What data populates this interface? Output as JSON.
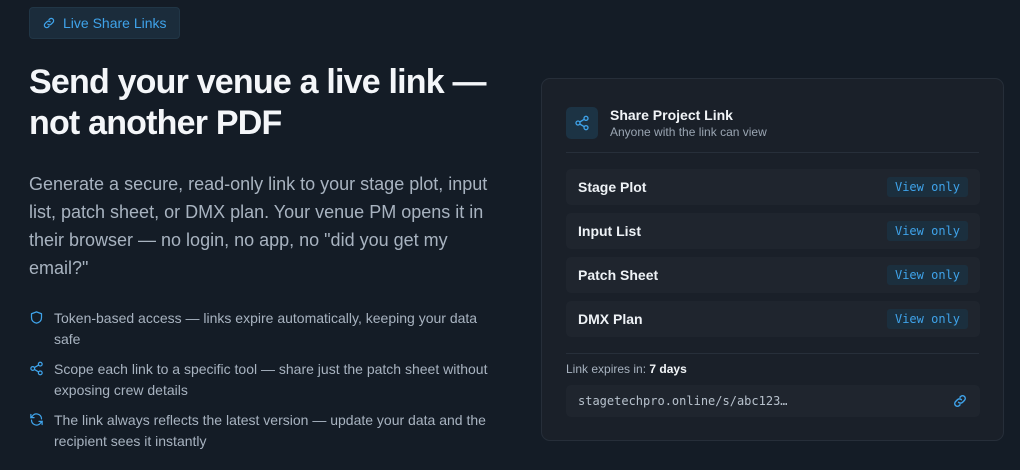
{
  "badge": {
    "label": "Live Share Links",
    "icon": "link-icon"
  },
  "hero": {
    "headline": "Send your venue a live link — not another PDF",
    "lead": "Generate a secure, read-only link to your stage plot, input list, patch sheet, or DMX plan. Your venue PM opens it in their browser — no login, no app, no \"did you get my email?\""
  },
  "features": [
    {
      "icon": "shield-icon",
      "text": "Token-based access — links expire automatically, keeping your data safe"
    },
    {
      "icon": "share-icon",
      "text": "Scope each link to a specific tool — share just the patch sheet without exposing crew details"
    },
    {
      "icon": "refresh-icon",
      "text": "The link always reflects the latest version — update your data and the recipient sees it instantly"
    }
  ],
  "card": {
    "title": "Share Project Link",
    "subtitle": "Anyone with the link can view",
    "items": [
      {
        "name": "Stage Plot",
        "access": "View only"
      },
      {
        "name": "Input List",
        "access": "View only"
      },
      {
        "name": "Patch Sheet",
        "access": "View only"
      },
      {
        "name": "DMX Plan",
        "access": "View only"
      }
    ],
    "expires_label": "Link expires in:",
    "expires_value": "7 days",
    "url": "stagetechpro.online/s/abc123…"
  },
  "colors": {
    "background": "#141c26",
    "accent": "#3fa3ea",
    "card": "#1a2029"
  }
}
